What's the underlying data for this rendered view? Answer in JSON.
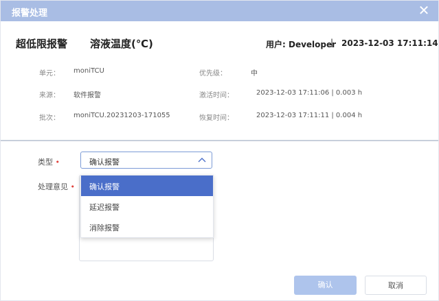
{
  "dialog": {
    "title": "报警处理",
    "close_symbol": "✕"
  },
  "header": {
    "alarm_type": "超低限报警",
    "sensor": "溶液温度(℃)",
    "user": "用户: Developer",
    "separator": "|",
    "time": "2023-12-03 17:11:14"
  },
  "info": {
    "unit_label": "单元：",
    "unit_value": "moniTCU",
    "priority_label": "优先级：",
    "priority_value": "中",
    "source_label": "来源：",
    "source_value": "软件报警",
    "activate_label": "激活时间：",
    "activate_value": "2023-12-03 17:11:06 | 0.003 h",
    "batch_label": "批次：",
    "batch_value": "moniTCU.20231203-171055",
    "recover_label": "恢复时间：",
    "recover_value": "2023-12-03 17:11:11 | 0.004 h"
  },
  "form": {
    "type_label": "类型",
    "opinion_label": "处理意见",
    "required_mark": "•",
    "selected_type": "确认报警",
    "options": [
      "确认报警",
      "延迟报警",
      "消除报警"
    ]
  },
  "buttons": {
    "ok": "确认",
    "cancel": "取消"
  },
  "colors": {
    "titlebar": "#a9bde4",
    "selected_option": "#4a6ec9",
    "ok_button": "#aec4ec",
    "required": "#e0403a"
  }
}
